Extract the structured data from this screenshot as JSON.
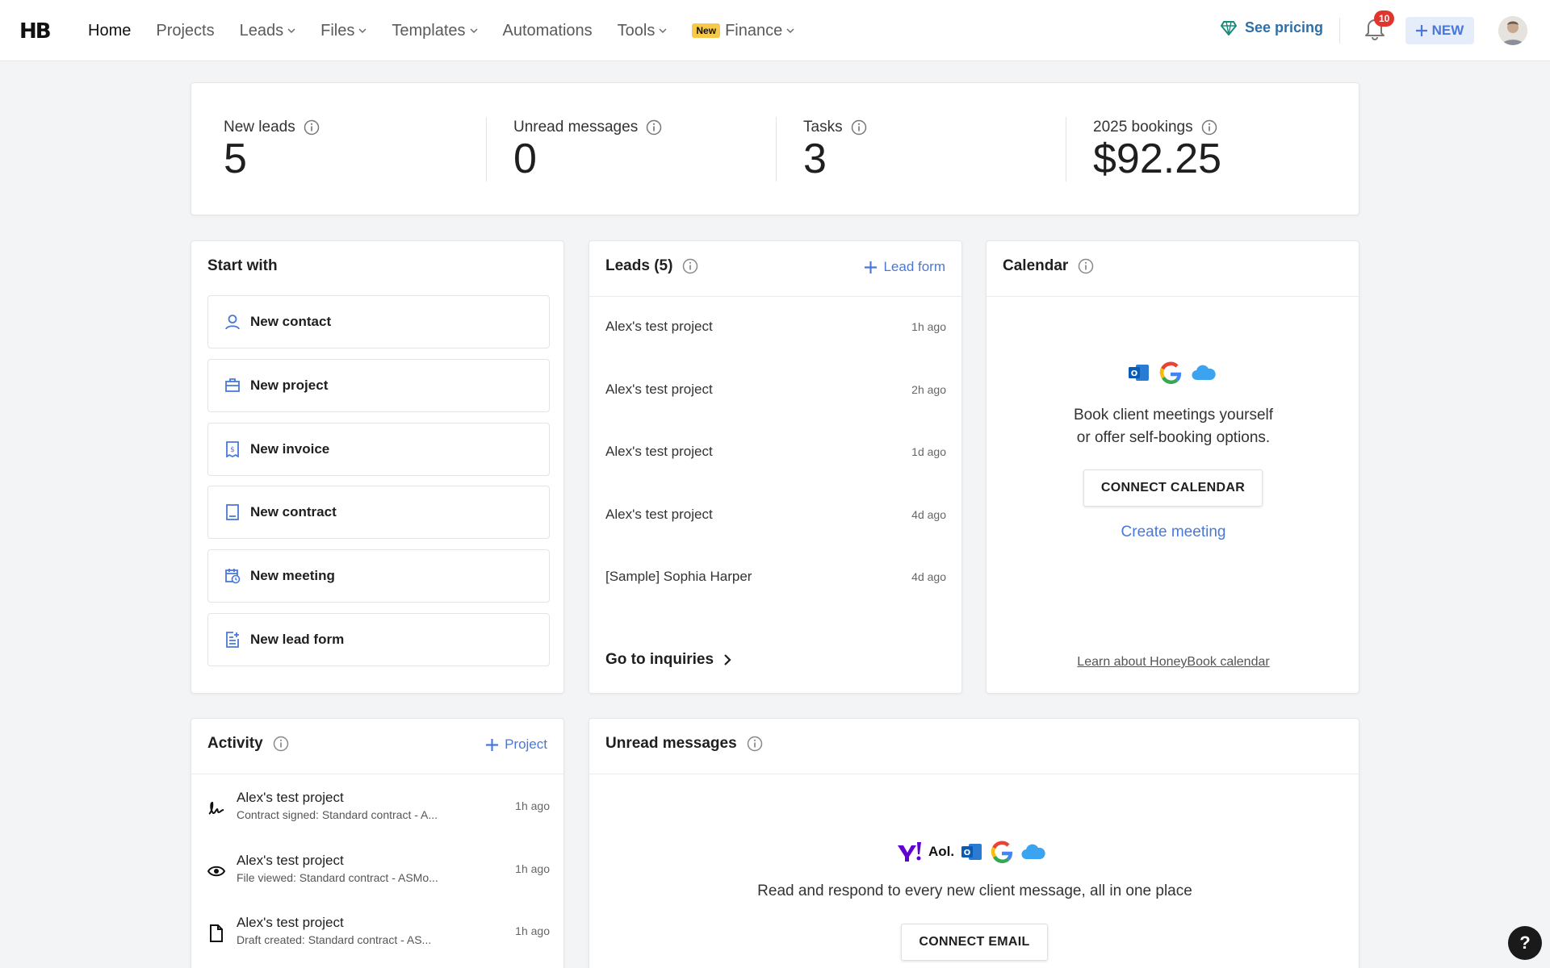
{
  "app": {
    "logo": "HB"
  },
  "nav": {
    "items": [
      {
        "label": "Home"
      },
      {
        "label": "Projects"
      },
      {
        "label": "Leads"
      },
      {
        "label": "Files"
      },
      {
        "label": "Templates"
      },
      {
        "label": "Automations"
      },
      {
        "label": "Tools"
      },
      {
        "label": "Finance",
        "badge": "New"
      }
    ],
    "pricing_label": "See pricing",
    "notification_count": "10",
    "new_button_label": "NEW"
  },
  "stats": [
    {
      "label": "New leads",
      "value": "5"
    },
    {
      "label": "Unread messages",
      "value": "0"
    },
    {
      "label": "Tasks",
      "value": "3"
    },
    {
      "label": "2025 bookings",
      "value": "$92.25"
    }
  ],
  "start_with": {
    "title": "Start with",
    "items": [
      {
        "label": "New contact",
        "icon": "user-icon"
      },
      {
        "label": "New project",
        "icon": "briefcase-icon"
      },
      {
        "label": "New invoice",
        "icon": "invoice-icon"
      },
      {
        "label": "New contract",
        "icon": "contract-icon"
      },
      {
        "label": "New meeting",
        "icon": "calendar-clock-icon"
      },
      {
        "label": "New lead form",
        "icon": "lead-form-icon"
      }
    ]
  },
  "leads": {
    "title": "Leads (5)",
    "action_label": "Lead form",
    "rows": [
      {
        "name": "Alex's test project",
        "time": "1h ago"
      },
      {
        "name": "Alex's test project",
        "time": "2h ago"
      },
      {
        "name": "Alex's test project",
        "time": "1d ago"
      },
      {
        "name": "Alex's test project",
        "time": "4d ago"
      },
      {
        "name": "[Sample] Sophia Harper",
        "time": "4d ago"
      }
    ],
    "footer_link": "Go to inquiries"
  },
  "calendar": {
    "title": "Calendar",
    "description_line1": "Book client meetings yourself",
    "description_line2": "or offer self-booking options.",
    "connect_label": "CONNECT CALENDAR",
    "create_meeting_label": "Create meeting",
    "learn_link": "Learn about HoneyBook calendar"
  },
  "activity": {
    "title": "Activity",
    "action_label": "Project",
    "rows": [
      {
        "title": "Alex's test project",
        "subtitle": "Contract signed: Standard contract - A...",
        "time": "1h ago",
        "icon": "signature-icon"
      },
      {
        "title": "Alex's test project",
        "subtitle": "File viewed: Standard contract - ASMo...",
        "time": "1h ago",
        "icon": "eye-icon"
      },
      {
        "title": "Alex's test project",
        "subtitle": "Draft created: Standard contract - AS...",
        "time": "1h ago",
        "icon": "document-icon"
      }
    ]
  },
  "unread": {
    "title": "Unread messages",
    "description": "Read and respond to every new client message, all in one place",
    "connect_label": "CONNECT EMAIL",
    "aol_label": "Aol."
  },
  "help_label": "?",
  "colors": {
    "accent": "#4a78d8",
    "pricing": "#2f6fa8",
    "badge": "#e0342c",
    "new_badge": "#f7c948"
  }
}
